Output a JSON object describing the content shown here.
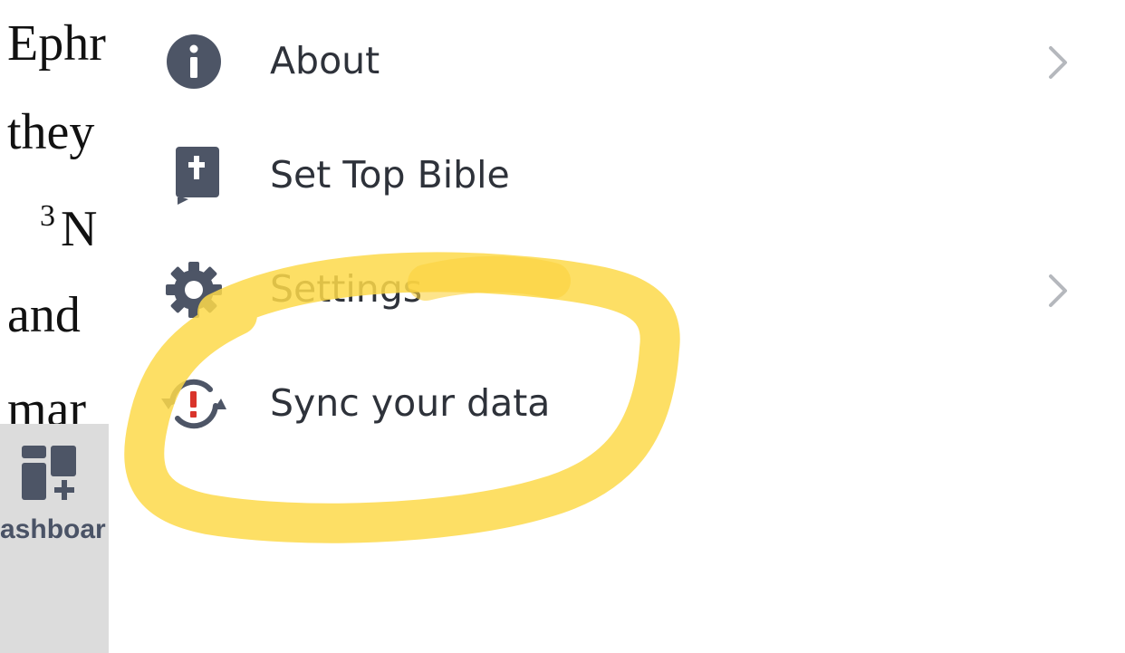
{
  "background": {
    "reading_lines": [
      {
        "verse": "",
        "text": "Ephr"
      },
      {
        "verse": "",
        "text": "they"
      },
      {
        "verse": "3",
        "text": "N"
      },
      {
        "verse": "",
        "text": "and"
      },
      {
        "verse": "",
        "text": "mar"
      }
    ],
    "dashboard_label": "ashboar"
  },
  "menu": {
    "items": [
      {
        "label": "About",
        "icon": "info-icon",
        "has_chevron": true
      },
      {
        "label": "Set Top Bible",
        "icon": "bible-icon",
        "has_chevron": false
      },
      {
        "label": "Settings",
        "icon": "gear-icon",
        "has_chevron": true
      },
      {
        "label": "Sync your data",
        "icon": "sync-alert-icon",
        "has_chevron": false
      }
    ]
  },
  "colors": {
    "icon": "#4d5566",
    "text": "#2e323a",
    "chevron": "#b5b8bd",
    "alert": "#d9342b",
    "highlight": "#fdd94a",
    "side_panel": "#dcdcdc"
  }
}
